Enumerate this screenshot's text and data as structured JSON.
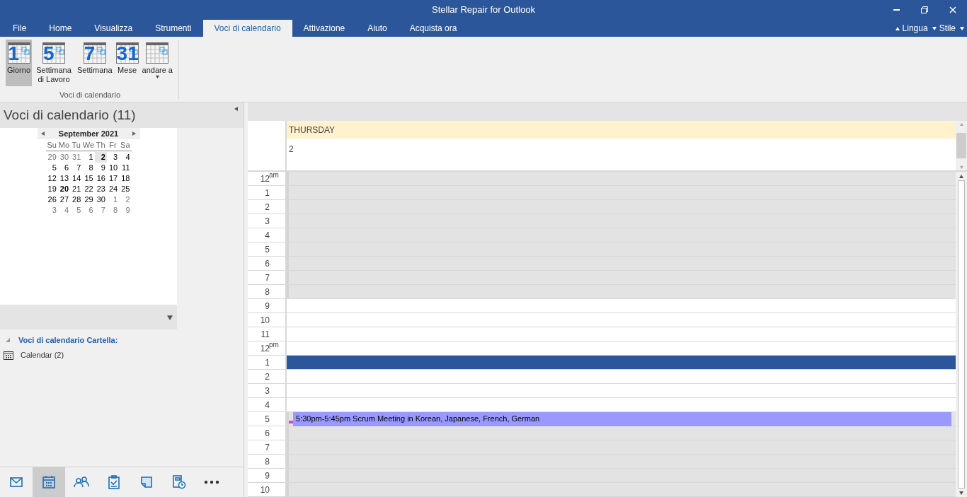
{
  "window": {
    "title": "Stellar Repair for Outlook"
  },
  "tabs": [
    {
      "label": "File",
      "selected": false
    },
    {
      "label": "Home",
      "selected": false
    },
    {
      "label": "Visualizza",
      "selected": false
    },
    {
      "label": "Strumenti",
      "selected": false
    },
    {
      "label": "Voci di calendario",
      "selected": true
    },
    {
      "label": "Attivazione",
      "selected": false
    },
    {
      "label": "Aiuto",
      "selected": false
    },
    {
      "label": "Acquista ora",
      "selected": false
    }
  ],
  "tab_right": [
    {
      "label": "Lingua",
      "kind": "up"
    },
    {
      "label": "Stile",
      "kind": "down"
    }
  ],
  "ribbon": {
    "group_label": "Voci di calendario",
    "buttons": [
      {
        "label": "Giorno",
        "icon_text": "1",
        "selected": true,
        "dropdown": false
      },
      {
        "label": "Settimana di Lavoro",
        "icon_text": "5",
        "selected": false,
        "dropdown": false
      },
      {
        "label": "Settimana",
        "icon_text": "7",
        "selected": false,
        "dropdown": false
      },
      {
        "label": "Mese",
        "icon_text": "31",
        "selected": false,
        "dropdown": false
      },
      {
        "label": "andare a",
        "selected": false,
        "dropdown": true
      }
    ]
  },
  "left_pane": {
    "title": "Voci di calendario (11)",
    "mini_calendar": {
      "month": "September 2021",
      "weekdays": [
        "Su",
        "Mo",
        "Tu",
        "We",
        "Th",
        "Fr",
        "Sa"
      ],
      "weeks": [
        [
          {
            "d": "29",
            "other": true,
            "bold": false,
            "selected": false
          },
          {
            "d": "30",
            "other": true,
            "bold": false,
            "selected": false
          },
          {
            "d": "31",
            "other": true,
            "bold": false,
            "selected": false
          },
          {
            "d": "1",
            "other": false,
            "bold": false,
            "selected": false
          },
          {
            "d": "2",
            "other": false,
            "bold": true,
            "selected": true
          },
          {
            "d": "3",
            "other": false,
            "bold": false,
            "selected": false
          },
          {
            "d": "4",
            "other": false,
            "bold": false,
            "selected": false
          }
        ],
        [
          {
            "d": "5",
            "other": false,
            "bold": false,
            "selected": false
          },
          {
            "d": "6",
            "other": false,
            "bold": false,
            "selected": false
          },
          {
            "d": "7",
            "other": false,
            "bold": false,
            "selected": false
          },
          {
            "d": "8",
            "other": false,
            "bold": false,
            "selected": false
          },
          {
            "d": "9",
            "other": false,
            "bold": false,
            "selected": false
          },
          {
            "d": "10",
            "other": false,
            "bold": false,
            "selected": false
          },
          {
            "d": "11",
            "other": false,
            "bold": false,
            "selected": false
          }
        ],
        [
          {
            "d": "12",
            "other": false,
            "bold": false,
            "selected": false
          },
          {
            "d": "13",
            "other": false,
            "bold": false,
            "selected": false
          },
          {
            "d": "14",
            "other": false,
            "bold": false,
            "selected": false
          },
          {
            "d": "15",
            "other": false,
            "bold": false,
            "selected": false
          },
          {
            "d": "16",
            "other": false,
            "bold": false,
            "selected": false
          },
          {
            "d": "17",
            "other": false,
            "bold": false,
            "selected": false
          },
          {
            "d": "18",
            "other": false,
            "bold": false,
            "selected": false
          }
        ],
        [
          {
            "d": "19",
            "other": false,
            "bold": false,
            "selected": false
          },
          {
            "d": "20",
            "other": false,
            "bold": true,
            "selected": false
          },
          {
            "d": "21",
            "other": false,
            "bold": false,
            "selected": false
          },
          {
            "d": "22",
            "other": false,
            "bold": false,
            "selected": false
          },
          {
            "d": "23",
            "other": false,
            "bold": false,
            "selected": false
          },
          {
            "d": "24",
            "other": false,
            "bold": false,
            "selected": false
          },
          {
            "d": "25",
            "other": false,
            "bold": false,
            "selected": false
          }
        ],
        [
          {
            "d": "26",
            "other": false,
            "bold": false,
            "selected": false
          },
          {
            "d": "27",
            "other": false,
            "bold": false,
            "selected": false
          },
          {
            "d": "28",
            "other": false,
            "bold": false,
            "selected": false
          },
          {
            "d": "29",
            "other": false,
            "bold": false,
            "selected": false
          },
          {
            "d": "30",
            "other": false,
            "bold": false,
            "selected": false
          },
          {
            "d": "1",
            "other": true,
            "bold": false,
            "selected": false
          },
          {
            "d": "2",
            "other": true,
            "bold": false,
            "selected": false
          }
        ],
        [
          {
            "d": "3",
            "other": true,
            "bold": false,
            "selected": false
          },
          {
            "d": "4",
            "other": true,
            "bold": false,
            "selected": false
          },
          {
            "d": "5",
            "other": true,
            "bold": false,
            "selected": false
          },
          {
            "d": "6",
            "other": true,
            "bold": false,
            "selected": false
          },
          {
            "d": "7",
            "other": true,
            "bold": false,
            "selected": false
          },
          {
            "d": "8",
            "other": true,
            "bold": false,
            "selected": false
          },
          {
            "d": "9",
            "other": true,
            "bold": false,
            "selected": false
          }
        ]
      ]
    },
    "folder_heading": "Voci di calendario Cartella:",
    "folders": [
      {
        "label": "Calendar (2)"
      }
    ]
  },
  "nav": [
    {
      "kind": "mail",
      "selected": false
    },
    {
      "kind": "calendar",
      "selected": true
    },
    {
      "kind": "people",
      "selected": false
    },
    {
      "kind": "tasks",
      "selected": false
    },
    {
      "kind": "notes",
      "selected": false
    },
    {
      "kind": "journal",
      "selected": false
    },
    {
      "kind": "more",
      "selected": false
    }
  ],
  "day_view": {
    "weekday": "THURSDAY",
    "date": "2",
    "hours": [
      {
        "label": "12",
        "suffix": "am",
        "working": false,
        "selected": false
      },
      {
        "label": "1",
        "working": false,
        "selected": false
      },
      {
        "label": "2",
        "working": false,
        "selected": false
      },
      {
        "label": "3",
        "working": false,
        "selected": false
      },
      {
        "label": "4",
        "working": false,
        "selected": false
      },
      {
        "label": "5",
        "working": false,
        "selected": false
      },
      {
        "label": "6",
        "working": false,
        "selected": false
      },
      {
        "label": "7",
        "working": false,
        "selected": false
      },
      {
        "label": "8",
        "working": false,
        "selected": false
      },
      {
        "label": "9",
        "working": true,
        "selected": false
      },
      {
        "label": "10",
        "working": true,
        "selected": false
      },
      {
        "label": "11",
        "working": true,
        "selected": false
      },
      {
        "label": "12",
        "suffix": "pm",
        "working": true,
        "selected": false
      },
      {
        "label": "1",
        "working": true,
        "selected": true
      },
      {
        "label": "2",
        "working": true,
        "selected": false
      },
      {
        "label": "3",
        "working": true,
        "selected": false
      },
      {
        "label": "4",
        "working": true,
        "selected": false
      },
      {
        "label": "5",
        "working": false,
        "selected": false,
        "event": {
          "text": "5:30pm-5:45pm Scrum Meeting in Korean, Japanese, French, German",
          "color": "#9999ff"
        }
      },
      {
        "label": "6",
        "working": false,
        "selected": false
      },
      {
        "label": "7",
        "working": false,
        "selected": false
      },
      {
        "label": "8",
        "working": false,
        "selected": false
      },
      {
        "label": "9",
        "working": false,
        "selected": false
      },
      {
        "label": "10",
        "working": false,
        "selected": false
      }
    ]
  }
}
